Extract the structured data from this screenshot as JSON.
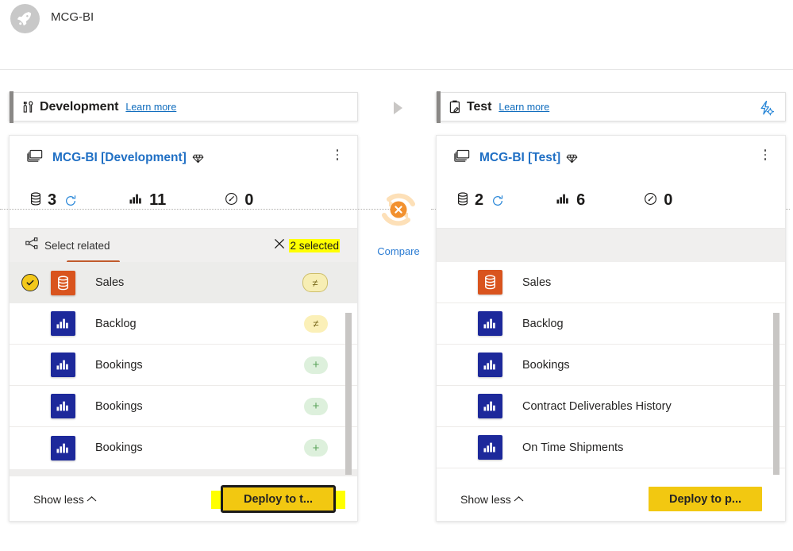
{
  "app": {
    "title": "MCG-BI",
    "avatar_icon": "rocket-icon"
  },
  "colors": {
    "accent_yellow": "#f2c811",
    "link_blue": "#0f6cbd",
    "workspace_blue": "#1f6fc4",
    "report_tile": "#1d299b",
    "dataset_tile": "#d9541e",
    "highlight": "#ffff00",
    "stage_accent": "#8a8886",
    "diff_badge": "#fbf0b8",
    "add_badge": "#ddf0dc",
    "compare_ring": "#fde0b8",
    "compare_badge": "#f2912f"
  },
  "center": {
    "compare_label": "Compare",
    "compare_icon": "compare-refresh-x-icon",
    "arrow_icon": "play-arrow-icon"
  },
  "stages": [
    {
      "id": "development",
      "name": "Development",
      "stage_icon": "tools-icon",
      "learn_more": "Learn more",
      "has_settings_icon": false,
      "workspace": {
        "name": "MCG-BI [Development]",
        "workspace_icon": "workspace-icon",
        "capacity_icon": "premium-gem-icon",
        "more_icon": "more-vertical-icon",
        "metrics": [
          {
            "icon": "dataset-icon",
            "value": "3",
            "refresh_icon": "refresh-icon"
          },
          {
            "icon": "report-icon",
            "value": "11",
            "refresh_icon": ""
          },
          {
            "icon": "dashboard-icon",
            "value": "0",
            "refresh_icon": ""
          }
        ]
      },
      "select_related": {
        "label": "Select related",
        "icon": "share-nodes-icon",
        "clear_icon": "close-icon",
        "count_text": "2 selected",
        "highlighted": true
      },
      "items": [
        {
          "name": "Sales",
          "type": "dataset",
          "icon": "dataset-tile-icon",
          "badge": "≠",
          "badge_type": "diff",
          "selected": true,
          "checked": true
        },
        {
          "name": "Backlog",
          "type": "report",
          "icon": "report-tile-icon",
          "badge": "≠",
          "badge_type": "diff",
          "selected": false,
          "checked": false
        },
        {
          "name": "Bookings",
          "type": "report",
          "icon": "report-tile-icon",
          "badge": "+",
          "badge_type": "add",
          "selected": false,
          "checked": false
        },
        {
          "name": "Bookings",
          "type": "report",
          "icon": "report-tile-icon",
          "badge": "+",
          "badge_type": "add",
          "selected": false,
          "checked": false
        },
        {
          "name": "Bookings",
          "type": "report",
          "icon": "report-tile-icon",
          "badge": "+",
          "badge_type": "add",
          "selected": false,
          "checked": false
        }
      ],
      "footer": {
        "show_less": "Show less",
        "show_less_icon": "chevron-up-icon",
        "deploy_label": "Deploy to t...",
        "deploy_focused": true,
        "deploy_highlighted": true
      }
    },
    {
      "id": "test",
      "name": "Test",
      "stage_icon": "clipboard-icon",
      "learn_more": "Learn more",
      "has_settings_icon": true,
      "settings_icon": "deployment-settings-icon",
      "workspace": {
        "name": "MCG-BI [Test]",
        "workspace_icon": "workspace-icon",
        "capacity_icon": "premium-gem-icon",
        "more_icon": "more-vertical-icon",
        "metrics": [
          {
            "icon": "dataset-icon",
            "value": "2",
            "refresh_icon": "refresh-icon"
          },
          {
            "icon": "report-icon",
            "value": "6",
            "refresh_icon": ""
          },
          {
            "icon": "dashboard-icon",
            "value": "0",
            "refresh_icon": ""
          }
        ]
      },
      "select_related": null,
      "items": [
        {
          "name": "Sales",
          "type": "dataset",
          "icon": "dataset-tile-icon",
          "badge": "",
          "badge_type": "",
          "selected": false,
          "checked": false
        },
        {
          "name": "Backlog",
          "type": "report",
          "icon": "report-tile-icon",
          "badge": "",
          "badge_type": "",
          "selected": false,
          "checked": false
        },
        {
          "name": "Bookings",
          "type": "report",
          "icon": "report-tile-icon",
          "badge": "",
          "badge_type": "",
          "selected": false,
          "checked": false
        },
        {
          "name": "Contract Deliverables History",
          "type": "report",
          "icon": "report-tile-icon",
          "badge": "",
          "badge_type": "",
          "selected": false,
          "checked": false
        },
        {
          "name": "On Time Shipments",
          "type": "report",
          "icon": "report-tile-icon",
          "badge": "",
          "badge_type": "",
          "selected": false,
          "checked": false
        }
      ],
      "footer": {
        "show_less": "Show less",
        "show_less_icon": "chevron-up-icon",
        "deploy_label": "Deploy to p...",
        "deploy_focused": false,
        "deploy_highlighted": false
      }
    }
  ]
}
